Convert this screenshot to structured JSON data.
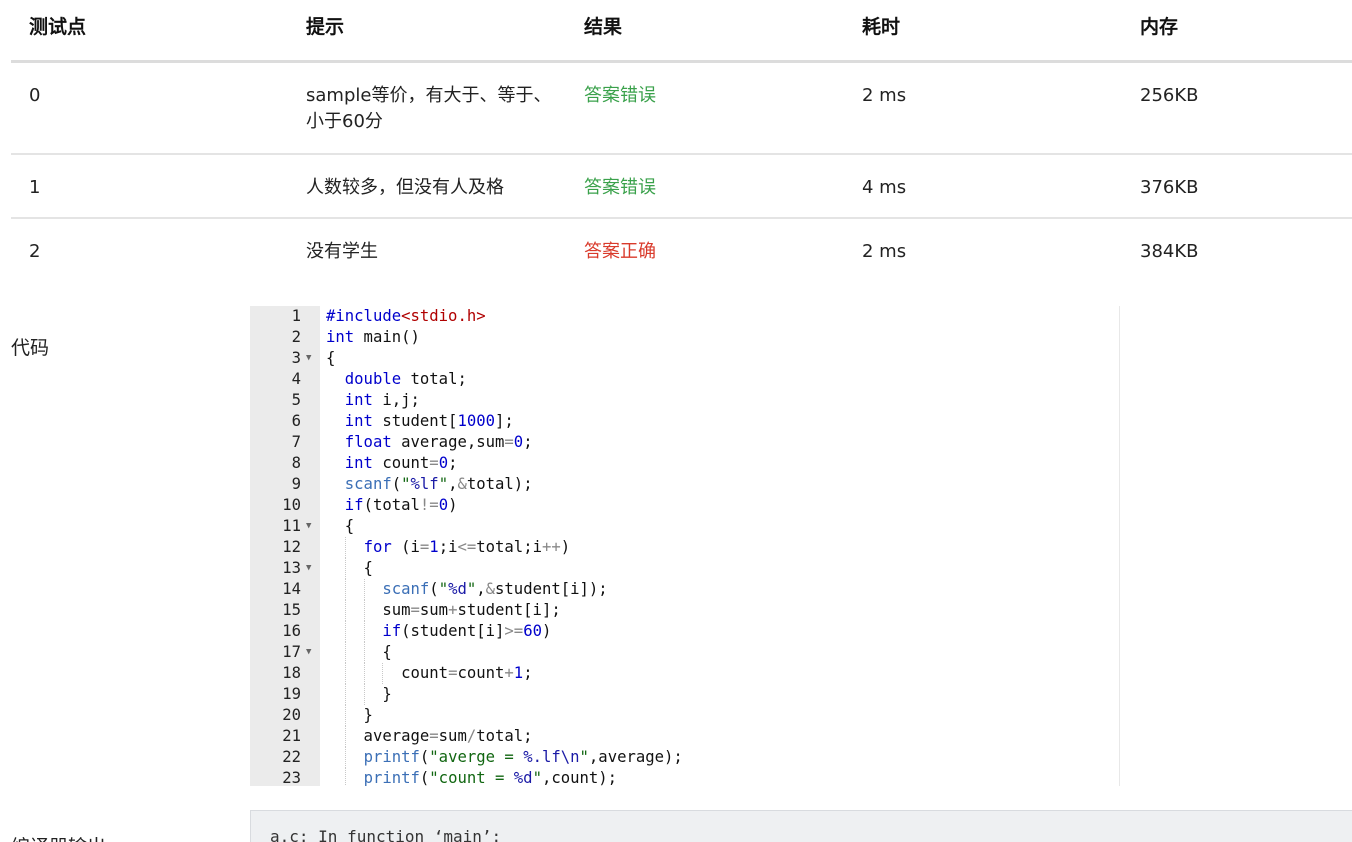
{
  "table": {
    "headers": {
      "id": "测试点",
      "hint": "提示",
      "result": "结果",
      "time": "耗时",
      "memory": "内存"
    },
    "rows": [
      {
        "id": "0",
        "hint": "sample等价，有大于、等于、小于60分",
        "result": "答案错误",
        "time": "2 ms",
        "memory": "256KB"
      },
      {
        "id": "1",
        "hint": "人数较多，但没有人及格",
        "result": "答案错误",
        "time": "4 ms",
        "memory": "376KB"
      },
      {
        "id": "2",
        "hint": "没有学生",
        "result": "答案正确",
        "time": "2 ms",
        "memory": "384KB"
      }
    ]
  },
  "colors": {
    "wrong_answer": "#3aa14b",
    "correct_answer": "#d93a2b",
    "keyword": "#0000cc",
    "string": "#1a1aa6",
    "include_string": "#b00000",
    "gutter_bg": "#ebebeb",
    "compile_bg": "#eef0f2"
  },
  "labels": {
    "code": "代码",
    "compile_output": "编译器输出"
  },
  "code": {
    "line_numbers": [
      "1",
      "2",
      "3",
      "4",
      "5",
      "6",
      "7",
      "8",
      "9",
      "10",
      "11",
      "12",
      "13",
      "14",
      "15",
      "16",
      "17",
      "18",
      "19",
      "20",
      "21",
      "22",
      "23"
    ],
    "fold_icon": "triangle-down-icon",
    "lines": [
      "#include<stdio.h>",
      "int main()",
      "{",
      "  double total;",
      "  int i,j;",
      "  int student[1000];",
      "  float average,sum=0;",
      "  int count=0;",
      "  scanf(\"%lf\",&total);",
      "  if(total!=0)",
      "  {",
      "    for (i=1;i<=total;i++)",
      "    {",
      "      scanf(\"%d\",&student[i]);",
      "      sum=sum+student[i];",
      "      if(student[i]>=60)",
      "      {",
      "        count=count+1;",
      "      }",
      "    }",
      "    average=sum/total;",
      "    printf(\"averge = %.lf\\n\",average);",
      "    printf(\"count = %d\",count);"
    ]
  },
  "compile_output": {
    "text": "a.c: In function ‘main’:"
  }
}
